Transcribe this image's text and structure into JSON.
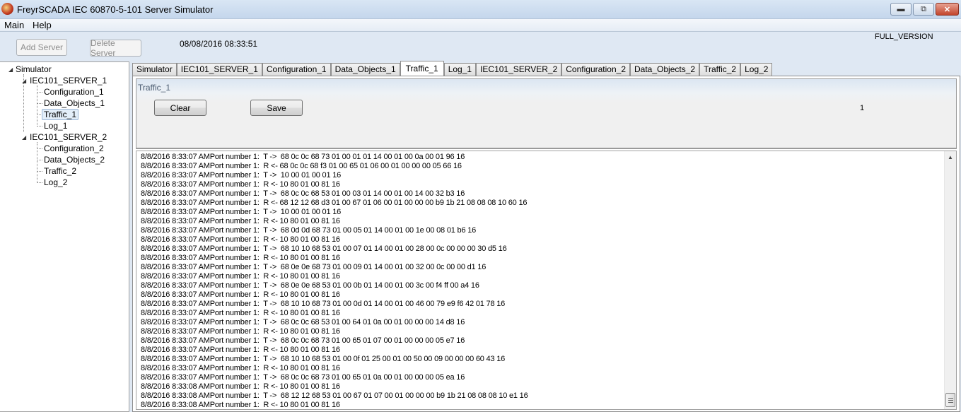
{
  "window": {
    "title": "FreyrSCADA IEC 60870-5-101 Server Simulator",
    "minimize_icon": "minimize-icon",
    "restore_icon": "restore-icon",
    "close_icon": "close-icon"
  },
  "menu": [
    "Main",
    "Help"
  ],
  "toolbar": {
    "add_server_label": "Add Server",
    "delete_server_label": "Delete Server",
    "datetime": "08/08/2016 08:33:51",
    "version": "FULL_VERSION"
  },
  "tree": {
    "root": "Simulator",
    "servers": [
      {
        "name": "IEC101_SERVER_1",
        "children": [
          "Configuration_1",
          "Data_Objects_1",
          "Traffic_1",
          "Log_1"
        ]
      },
      {
        "name": "IEC101_SERVER_2",
        "children": [
          "Configuration_2",
          "Data_Objects_2",
          "Traffic_2",
          "Log_2"
        ]
      }
    ],
    "selected": "Traffic_1"
  },
  "tabs": [
    "Simulator",
    "IEC101_SERVER_1",
    "Configuration_1",
    "Data_Objects_1",
    "Traffic_1",
    "Log_1",
    "IEC101_SERVER_2",
    "Configuration_2",
    "Data_Objects_2",
    "Traffic_2",
    "Log_2"
  ],
  "active_tab": "Traffic_1",
  "traffic": {
    "panel_title": "Traffic_1",
    "clear_label": "Clear",
    "save_label": "Save",
    "counter": "1",
    "log": [
      "8/8/2016 8:33:07 AMPort number 1:  T ->  68 0c 0c 68 73 01 00 01 01 14 00 01 00 0a 00 01 96 16",
      "8/8/2016 8:33:07 AMPort number 1:  R <- 68 0c 0c 68 f3 01 00 65 01 06 00 01 00 00 00 05 66 16",
      "8/8/2016 8:33:07 AMPort number 1:  T ->  10 00 01 00 01 16",
      "8/8/2016 8:33:07 AMPort number 1:  R <- 10 80 01 00 81 16",
      "8/8/2016 8:33:07 AMPort number 1:  T ->  68 0c 0c 68 53 01 00 03 01 14 00 01 00 14 00 32 b3 16",
      "8/8/2016 8:33:07 AMPort number 1:  R <- 68 12 12 68 d3 01 00 67 01 06 00 01 00 00 00 b9 1b 21 08 08 08 10 60 16",
      "8/8/2016 8:33:07 AMPort number 1:  T ->  10 00 01 00 01 16",
      "8/8/2016 8:33:07 AMPort number 1:  R <- 10 80 01 00 81 16",
      "8/8/2016 8:33:07 AMPort number 1:  T ->  68 0d 0d 68 73 01 00 05 01 14 00 01 00 1e 00 08 01 b6 16",
      "8/8/2016 8:33:07 AMPort number 1:  R <- 10 80 01 00 81 16",
      "8/8/2016 8:33:07 AMPort number 1:  T ->  68 10 10 68 53 01 00 07 01 14 00 01 00 28 00 0c 00 00 00 30 d5 16",
      "8/8/2016 8:33:07 AMPort number 1:  R <- 10 80 01 00 81 16",
      "8/8/2016 8:33:07 AMPort number 1:  T ->  68 0e 0e 68 73 01 00 09 01 14 00 01 00 32 00 0c 00 00 d1 16",
      "8/8/2016 8:33:07 AMPort number 1:  R <- 10 80 01 00 81 16",
      "8/8/2016 8:33:07 AMPort number 1:  T ->  68 0e 0e 68 53 01 00 0b 01 14 00 01 00 3c 00 f4 ff 00 a4 16",
      "8/8/2016 8:33:07 AMPort number 1:  R <- 10 80 01 00 81 16",
      "8/8/2016 8:33:07 AMPort number 1:  T ->  68 10 10 68 73 01 00 0d 01 14 00 01 00 46 00 79 e9 f6 42 01 78 16",
      "8/8/2016 8:33:07 AMPort number 1:  R <- 10 80 01 00 81 16",
      "8/8/2016 8:33:07 AMPort number 1:  T ->  68 0c 0c 68 53 01 00 64 01 0a 00 01 00 00 00 14 d8 16",
      "8/8/2016 8:33:07 AMPort number 1:  R <- 10 80 01 00 81 16",
      "8/8/2016 8:33:07 AMPort number 1:  T ->  68 0c 0c 68 73 01 00 65 01 07 00 01 00 00 00 05 e7 16",
      "8/8/2016 8:33:07 AMPort number 1:  R <- 10 80 01 00 81 16",
      "8/8/2016 8:33:07 AMPort number 1:  T ->  68 10 10 68 53 01 00 0f 01 25 00 01 00 50 00 09 00 00 00 60 43 16",
      "8/8/2016 8:33:07 AMPort number 1:  R <- 10 80 01 00 81 16",
      "8/8/2016 8:33:07 AMPort number 1:  T ->  68 0c 0c 68 73 01 00 65 01 0a 00 01 00 00 00 05 ea 16",
      "8/8/2016 8:33:08 AMPort number 1:  R <- 10 80 01 00 81 16",
      "8/8/2016 8:33:08 AMPort number 1:  T ->  68 12 12 68 53 01 00 67 01 07 00 01 00 00 00 b9 1b 21 08 08 08 10 e1 16",
      "8/8/2016 8:33:08 AMPort number 1:  R <- 10 80 01 00 81 16"
    ]
  }
}
